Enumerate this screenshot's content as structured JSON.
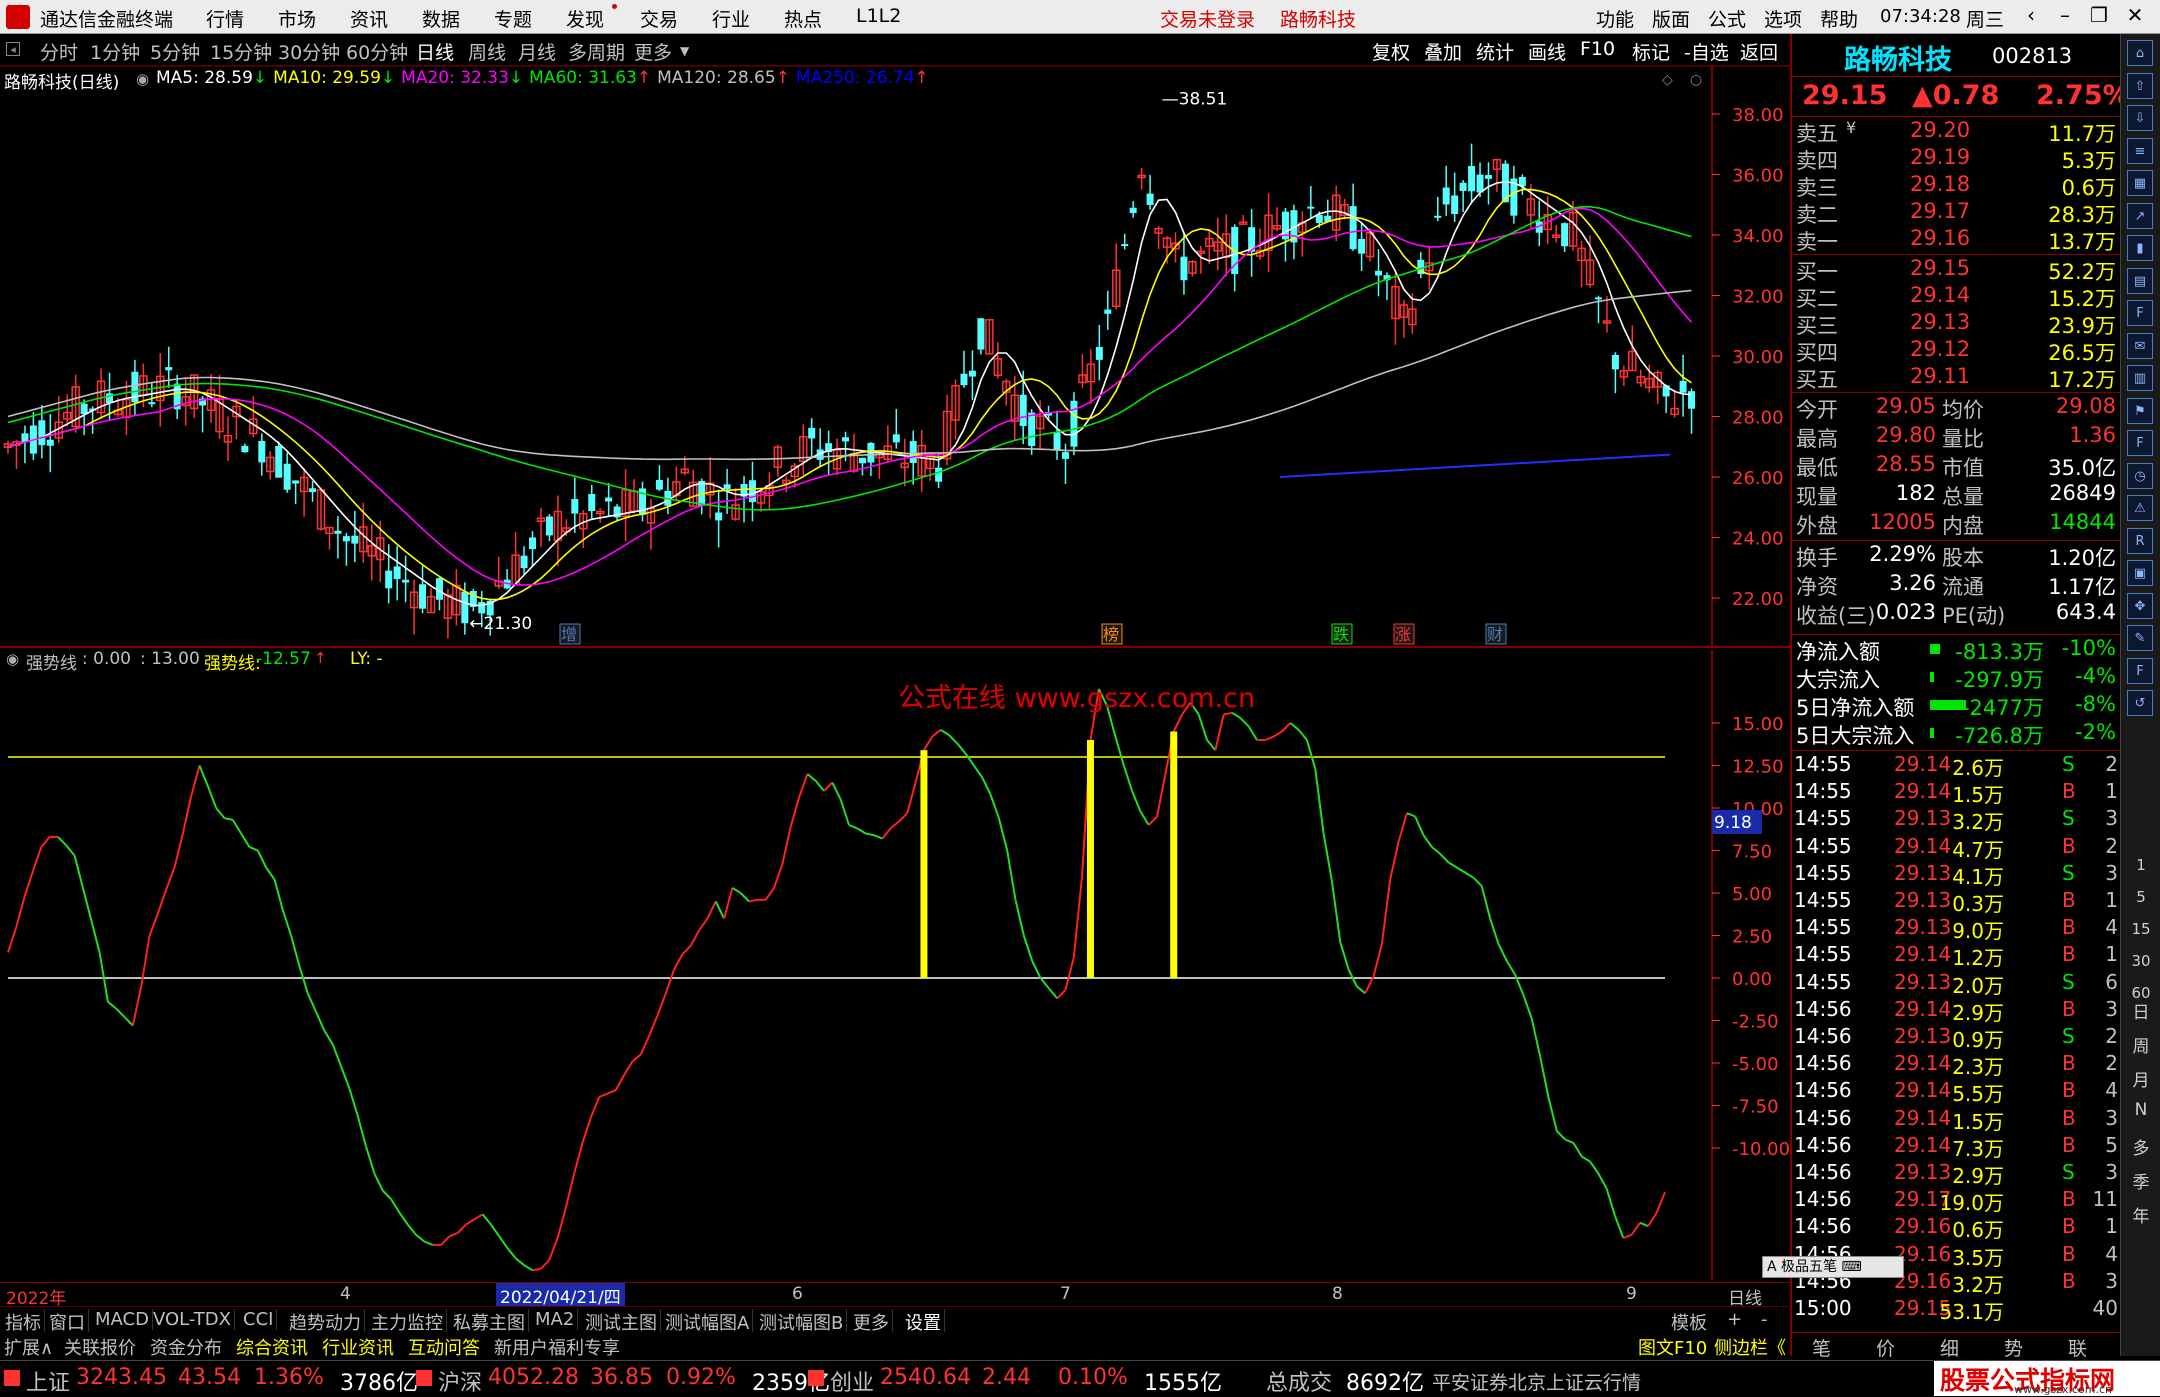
{
  "menubar": {
    "app_title": "通达信金融终端",
    "items": [
      "行情",
      "市场",
      "资讯",
      "数据",
      "专题",
      "发现",
      "交易",
      "行业",
      "热点",
      "L1L2"
    ],
    "login": "交易未登录",
    "stock_name": "路畅科技",
    "right_items": [
      "功能",
      "版面",
      "公式",
      "选项",
      "帮助"
    ],
    "clock": "07:34:28",
    "weekday": "周三"
  },
  "periodbar": {
    "periods": [
      "分时",
      "1分钟",
      "5分钟",
      "15分钟",
      "30分钟",
      "60分钟",
      "日线",
      "周线",
      "月线",
      "多周期",
      "更多"
    ],
    "active": "日线",
    "tools": [
      "复权",
      "叠加",
      "统计",
      "画线",
      "F10",
      "标记",
      "-自选",
      "返回"
    ]
  },
  "main_chart": {
    "title": "路畅科技(日线)",
    "ma_labels": [
      {
        "text": "MA5: 28.59",
        "arrow": "↓",
        "color": "#ffffff"
      },
      {
        "text": "MA10: 29.59",
        "arrow": "↓",
        "color": "#ffff00"
      },
      {
        "text": "MA20: 32.33",
        "arrow": "↓",
        "color": "#ff00ff"
      },
      {
        "text": "MA60: 31.63",
        "arrow": "↑",
        "color": "#00e600"
      },
      {
        "text": "MA120: 28.65",
        "arrow": "↑",
        "color": "#c0c0c0"
      },
      {
        "text": "MA250: 26.74",
        "arrow": "↑",
        "color": "#0000ff"
      }
    ],
    "y_ticks": [
      "38.00",
      "36.00",
      "34.00",
      "32.00",
      "30.00",
      "28.00",
      "26.00",
      "24.00",
      "22.00"
    ],
    "high_label": "38.51",
    "low_label": "21.30",
    "markers": [
      "增",
      "榜",
      "跌",
      "涨",
      "财"
    ]
  },
  "indicator": {
    "header": {
      "name": "强势线",
      "val1": ": 0.00",
      "val2": ": 13.00",
      "name2": "强势线:",
      "val3": "-12.57",
      "extra": "LY: -"
    },
    "watermark": "公式在线  www.gszx.com.cn",
    "y_ticks": [
      "15.00",
      "12.50",
      "10.00",
      "7.50",
      "5.00",
      "2.50",
      "0.00",
      "-2.50",
      "-5.00",
      "-7.50",
      "-10.00"
    ],
    "current_value": "9.18"
  },
  "chart_data": [
    {
      "type": "line",
      "title": "强势线",
      "ylim": [
        -17.5,
        17.5
      ],
      "hlines": [
        13.0,
        0.0
      ],
      "x": [
        0,
        1,
        2,
        3,
        4,
        5,
        6,
        7,
        8,
        9,
        10,
        11,
        12,
        13,
        14,
        15,
        16,
        17,
        18,
        19,
        20,
        21,
        22,
        23,
        24,
        25,
        26,
        27,
        28,
        29,
        30,
        31,
        32,
        33,
        34,
        35,
        36,
        37,
        38,
        39,
        40,
        41,
        42,
        43,
        44,
        45,
        46,
        47,
        48,
        49,
        50,
        51,
        52,
        53,
        54,
        55,
        56,
        57,
        58,
        59,
        60,
        61,
        62,
        63,
        64,
        65,
        66,
        67,
        68,
        69,
        70,
        71,
        72,
        73,
        74,
        75,
        76,
        77,
        78,
        79,
        80,
        81,
        82,
        83,
        84,
        85,
        86,
        87,
        88,
        89,
        90,
        91,
        92,
        93,
        94,
        95,
        96,
        97,
        98,
        99,
        100,
        101,
        102,
        103,
        104,
        105,
        106,
        107,
        108,
        109,
        110,
        111,
        112,
        113,
        114,
        115,
        116,
        117,
        118,
        119,
        120,
        121,
        122,
        123,
        124,
        125,
        126,
        127,
        128,
        129,
        130,
        131,
        132,
        133,
        134,
        135,
        136,
        137,
        138,
        139,
        140,
        141,
        142,
        143,
        144,
        145,
        146,
        147,
        148,
        149,
        150,
        151,
        152,
        153,
        154,
        155,
        156,
        157,
        158,
        159,
        160,
        161,
        162,
        163,
        164,
        165,
        166,
        167,
        168,
        169,
        170,
        171,
        172,
        173,
        174,
        175,
        176,
        177,
        178,
        179,
        180,
        181,
        182,
        183,
        184,
        185,
        186,
        187,
        188,
        189,
        190,
        191,
        192,
        193,
        194,
        195,
        196,
        197,
        198,
        199,
        200,
        201,
        202,
        203,
        204,
        205,
        206,
        207,
        208,
        209,
        210,
        211,
        212,
        213,
        214,
        215,
        216,
        217,
        218,
        219,
        220,
        221,
        222,
        223,
        224,
        225,
        226,
        227,
        228,
        229,
        230,
        231,
        232,
        233,
        234,
        235,
        236,
        237,
        238,
        239,
        240
      ],
      "series": [
        {
          "values": [
            1.5,
            3,
            4.8,
            6.3,
            7.7,
            8.3,
            8.3,
            7.8,
            7.2,
            5.3,
            3.4,
            1.5,
            -1.4,
            -1.8,
            -2.3,
            -2.8,
            -0.5,
            2.5,
            3.8,
            5.2,
            6.5,
            8.5,
            10.7,
            12.5,
            11.3,
            10,
            9.4,
            9.3,
            8.5,
            7.7,
            7.5,
            6.5,
            5.8,
            4,
            2.5,
            0.7,
            -0.9,
            -2,
            -3.1,
            -3.9,
            -5.2,
            -6.5,
            -8.1,
            -9.9,
            -11.5,
            -12.5,
            -13,
            -13.8,
            -14.5,
            -15.1,
            -15.5,
            -15.7,
            -15.7,
            -15.2,
            -15,
            -14.5,
            -14.2,
            -13.9,
            -14.5,
            -15.2,
            -15.9,
            -16.5,
            -16.9,
            -17.2,
            -17.1,
            -16.6,
            -15.3,
            -13.5,
            -11.5,
            -9.7,
            -8.2,
            -7,
            -6.8,
            -6.6,
            -5.7,
            -4.9,
            -4.5,
            -3.4,
            -2.2,
            -0.9,
            0.5,
            1.4,
            1.9,
            2.8,
            3.5,
            4.5,
            3.5,
            5.3,
            5,
            4.5,
            4.6,
            4.6,
            5.3,
            6.7,
            8.9,
            10.6,
            12,
            11.6,
            11,
            11.5,
            10.5,
            9,
            8.8,
            8.5,
            8.4,
            8.2,
            8.8,
            9.2,
            9.7,
            11.5,
            13.4,
            14.2,
            14.6,
            14.3,
            13.8,
            13.2,
            12.5,
            11.8,
            10.8,
            9.4,
            7.5,
            4.6,
            2.5,
            1,
            0,
            -0.6,
            -1.2,
            -0.7,
            1.2,
            6,
            14,
            17,
            16,
            14.2,
            12.5,
            11,
            9.8,
            9,
            9.5,
            12,
            14.5,
            15.5,
            16.2,
            15.5,
            14,
            13.4,
            15.5,
            15.6,
            15.3,
            14.8,
            14,
            14,
            14.2,
            14.5,
            15,
            14.6,
            14,
            12.3,
            8.5,
            5.7,
            2.1,
            0.5,
            -0.5,
            -0.9,
            0.1,
            2,
            5.8,
            8,
            9.7,
            9.5,
            8.4,
            7.7,
            7.3,
            6.8,
            6.5,
            6.2,
            5.9,
            5.4,
            3.5,
            2,
            1,
            0.2,
            -1,
            -2.4,
            -4.6,
            -7,
            -9,
            -9.5,
            -9.7,
            -10.5,
            -10.8,
            -11.5,
            -12.4,
            -14,
            -15.3,
            -15.1,
            -14.4,
            -14.6,
            -13.8,
            -12.6
          ]
        }
      ]
    }
  ],
  "quote": {
    "name": "路畅科技",
    "code": "002813",
    "price": "29.15",
    "change": "▲0.78",
    "pct": "2.75%",
    "asks": [
      {
        "label": "卖五",
        "mark": "¥",
        "price": "29.20",
        "vol": "11.7万"
      },
      {
        "label": "卖四",
        "mark": "",
        "price": "29.19",
        "vol": "5.3万"
      },
      {
        "label": "卖三",
        "mark": "",
        "price": "29.18",
        "vol": "0.6万"
      },
      {
        "label": "卖二",
        "mark": "",
        "price": "29.17",
        "vol": "28.3万"
      },
      {
        "label": "卖一",
        "mark": "",
        "price": "29.16",
        "vol": "13.7万"
      }
    ],
    "bids": [
      {
        "label": "买一",
        "price": "29.15",
        "vol": "52.2万"
      },
      {
        "label": "买二",
        "price": "29.14",
        "vol": "15.2万"
      },
      {
        "label": "买三",
        "price": "29.13",
        "vol": "23.9万"
      },
      {
        "label": "买四",
        "price": "29.12",
        "vol": "26.5万"
      },
      {
        "label": "买五",
        "price": "29.11",
        "vol": "17.2万"
      }
    ],
    "stats": [
      {
        "l1": "今开",
        "v1": "29.05",
        "c1": "red",
        "l2": "均价",
        "v2": "29.08",
        "c2": "red"
      },
      {
        "l1": "最高",
        "v1": "29.80",
        "c1": "red",
        "l2": "量比",
        "v2": "1.36",
        "c2": "red"
      },
      {
        "l1": "最低",
        "v1": "28.55",
        "c1": "red",
        "l2": "市值",
        "v2": "35.0亿",
        "c2": "wht"
      },
      {
        "l1": "现量",
        "v1": "182",
        "c1": "wht",
        "l2": "总量",
        "v2": "26849",
        "c2": "wht"
      },
      {
        "l1": "外盘",
        "v1": "12005",
        "c1": "red",
        "l2": "内盘",
        "v2": "14844",
        "c2": "grn"
      }
    ],
    "stats2": [
      {
        "l1": "换手",
        "v1": "2.29%",
        "l2": "股本",
        "v2": "1.20亿"
      },
      {
        "l1": "净资",
        "v1": "3.26",
        "l2": "流通",
        "v2": "1.17亿"
      },
      {
        "l1": "收益(三)",
        "v1": "0.023",
        "l2": "PE(动)",
        "v2": "643.4"
      }
    ],
    "flows": [
      {
        "label": "净流入额",
        "value": "-813.3万",
        "pct": "-10%",
        "bar": 10
      },
      {
        "label": "大宗流入",
        "value": "-297.9万",
        "pct": "-4%",
        "bar": 4
      },
      {
        "label": "5日净流入额",
        "value": "-2477万",
        "pct": "-8%",
        "bar": 36
      },
      {
        "label": "5日大宗流入",
        "value": "-726.8万",
        "pct": "-2%",
        "bar": 4
      }
    ],
    "ticks": [
      {
        "t": "14:55",
        "p": "29.14",
        "v": "2.6万",
        "s": "S",
        "n": "2"
      },
      {
        "t": "14:55",
        "p": "29.14",
        "v": "1.5万",
        "s": "B",
        "n": "1"
      },
      {
        "t": "14:55",
        "p": "29.13",
        "v": "3.2万",
        "s": "S",
        "n": "3"
      },
      {
        "t": "14:55",
        "p": "29.14",
        "v": "4.7万",
        "s": "B",
        "n": "2"
      },
      {
        "t": "14:55",
        "p": "29.13",
        "v": "4.1万",
        "s": "S",
        "n": "3"
      },
      {
        "t": "14:55",
        "p": "29.13",
        "v": "0.3万",
        "s": "B",
        "n": "1"
      },
      {
        "t": "14:55",
        "p": "29.13",
        "v": "9.0万",
        "s": "B",
        "n": "4"
      },
      {
        "t": "14:55",
        "p": "29.14",
        "v": "1.2万",
        "s": "B",
        "n": "1"
      },
      {
        "t": "14:55",
        "p": "29.13",
        "v": "2.0万",
        "s": "S",
        "n": "6"
      },
      {
        "t": "14:56",
        "p": "29.14",
        "v": "2.9万",
        "s": "B",
        "n": "3"
      },
      {
        "t": "14:56",
        "p": "29.13",
        "v": "0.9万",
        "s": "S",
        "n": "2"
      },
      {
        "t": "14:56",
        "p": "29.14",
        "v": "2.3万",
        "s": "B",
        "n": "2"
      },
      {
        "t": "14:56",
        "p": "29.14",
        "v": "5.5万",
        "s": "B",
        "n": "4"
      },
      {
        "t": "14:56",
        "p": "29.14",
        "v": "1.5万",
        "s": "B",
        "n": "3"
      },
      {
        "t": "14:56",
        "p": "29.14",
        "v": "7.3万",
        "s": "B",
        "n": "5"
      },
      {
        "t": "14:56",
        "p": "29.13",
        "v": "2.9万",
        "s": "S",
        "n": "3"
      },
      {
        "t": "14:56",
        "p": "29.17",
        "v": "19.0万",
        "s": "B",
        "n": "11"
      },
      {
        "t": "14:56",
        "p": "29.16",
        "v": "0.6万",
        "s": "B",
        "n": "1"
      },
      {
        "t": "14:56",
        "p": "29.16",
        "v": "3.5万",
        "s": "B",
        "n": "4"
      },
      {
        "t": "14:56",
        "p": "29.16",
        "v": "3.2万",
        "s": "B",
        "n": "3"
      },
      {
        "t": "15:00",
        "p": "29.15",
        "v": "53.1万",
        "s": "",
        "n": "40"
      }
    ],
    "tick_buttons": "A 极品五笔 ⌨",
    "bottom_tabs": [
      "笔",
      "价",
      "细",
      "势",
      "联"
    ]
  },
  "axis": {
    "year": "2022年",
    "months": [
      "4",
      "6",
      "7",
      "8",
      "9"
    ],
    "date_highlight": "2022/04/21/四",
    "period_label": "日线"
  },
  "tabs1": [
    "指标",
    "窗口",
    "MACD",
    "VOL-TDX",
    "CCI",
    "趋势动力",
    "主力监控",
    "私募主图",
    "MA2",
    "测试主图",
    "测试幅图A",
    "测试幅图B",
    "更多",
    "设置"
  ],
  "tabs1_right": [
    "模板",
    "+",
    "-"
  ],
  "tabs2": [
    {
      "label": "扩展∧",
      "color": "#c0c0c0"
    },
    {
      "label": "关联报价",
      "color": "#c0c0c0"
    },
    {
      "label": "资金分布",
      "color": "#c0c0c0"
    },
    {
      "label": "综合资讯",
      "color": "#ffff00"
    },
    {
      "label": "行业资讯",
      "color": "#ffff00"
    },
    {
      "label": "互动问答",
      "color": "#ffff00"
    },
    {
      "label": "新用户福利专享",
      "color": "#c0c0c0"
    }
  ],
  "tabs2_right": [
    "图文F10",
    "侧边栏《"
  ],
  "statusbar": {
    "items": [
      {
        "name": "上证",
        "price": "3243.45",
        "chg": "43.54",
        "pct": "1.36%",
        "amt": "3786亿"
      },
      {
        "name": "沪深",
        "price": "4052.28",
        "chg": "36.85",
        "pct": "0.92%",
        "amt": "2359亿"
      },
      {
        "name": "创业",
        "price": "2540.64",
        "chg": "2.44",
        "pct": "0.10%",
        "amt": "1555亿"
      }
    ],
    "total_label": "总成交",
    "total": "8692亿",
    "server": "平安证券北京上证云行情",
    "brand": "股票公式指标网",
    "brand_url": "www.gszx.com.cn"
  },
  "sidebar": {
    "words": [
      "日",
      "周",
      "月",
      "N",
      "多",
      "季",
      "年"
    ],
    "nums": [
      "1",
      "5",
      "15",
      "30",
      "60"
    ]
  }
}
